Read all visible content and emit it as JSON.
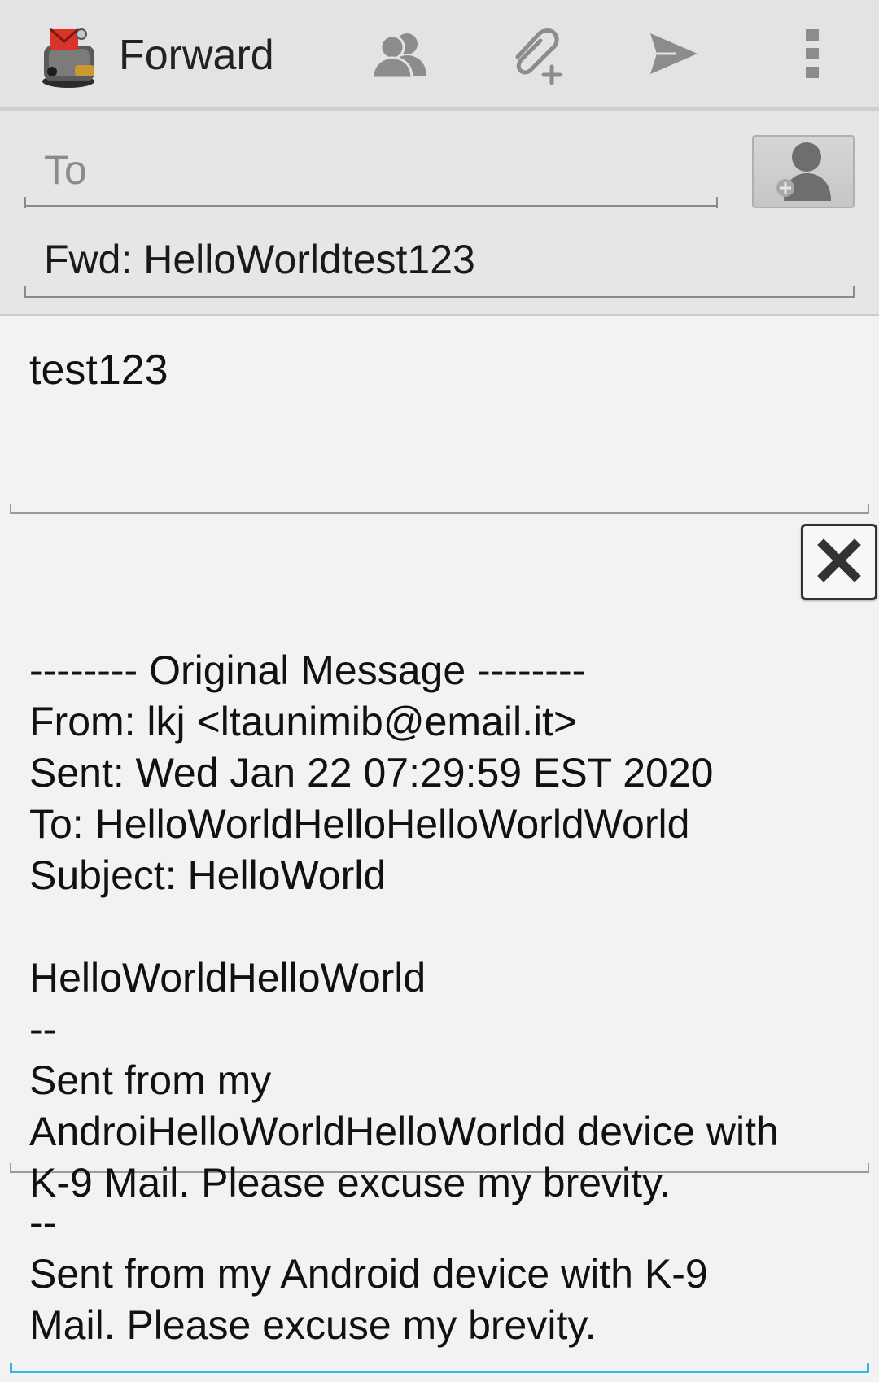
{
  "action_bar": {
    "title": "Forward",
    "icons": {
      "app": "k9-mail-icon",
      "contacts": "contacts-icon",
      "attach": "attach-icon",
      "send": "send-icon",
      "overflow": "overflow-menu-icon"
    }
  },
  "header": {
    "to_placeholder": "To",
    "to_value": "",
    "subject": "Fwd: HelloWorldtest123",
    "add_contact_icon": "add-contact-icon"
  },
  "message": {
    "body": "test123"
  },
  "quoted": {
    "lines": [
      "",
      "-------- Original Message --------",
      "From: lkj <ltaunimib@email.it>",
      "Sent: Wed Jan 22 07:29:59 EST 2020",
      "To: HelloWorldHelloHelloWorldWorld",
      "Subject: HelloWorld",
      "",
      "HelloWorldHelloWorld",
      "--",
      "Sent from my",
      "AndroiHelloWorldHelloWorldd device with",
      "K-9 Mail. Please excuse my brevity."
    ],
    "close_icon": "close-icon"
  },
  "signature": {
    "lines": [
      "--",
      "Sent from my Android device with K-9",
      "Mail. Please excuse my brevity."
    ]
  },
  "colors": {
    "action_bar_bg": "#e3e3e3",
    "background": "#f2f2f2",
    "focus_accent": "#33b5e5"
  }
}
